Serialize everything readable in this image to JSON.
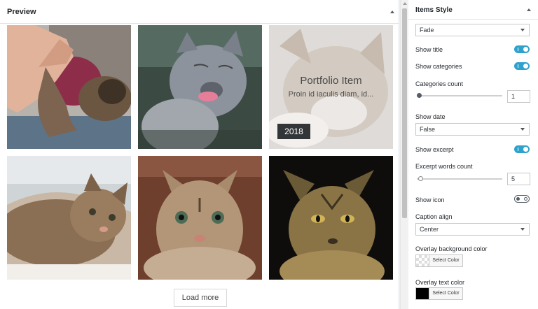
{
  "preview": {
    "title": "Preview",
    "overlay": {
      "title": "Portfolio Item",
      "excerpt": "Proin id iaculis diam, id...",
      "date": "2018"
    },
    "load_more": "Load more"
  },
  "settings": {
    "title": "Items Style",
    "style_select": "Fade",
    "show_title": {
      "label": "Show title",
      "on": true
    },
    "show_categories": {
      "label": "Show categories",
      "on": true
    },
    "categories_count": {
      "label": "Categories count",
      "value": "1"
    },
    "show_date": {
      "label": "Show date",
      "value": "False"
    },
    "show_excerpt": {
      "label": "Show excerpt",
      "on": true
    },
    "excerpt_words_count": {
      "label": "Excerpt words count",
      "value": "5"
    },
    "show_icon": {
      "label": "Show icon",
      "on": false
    },
    "caption_align": {
      "label": "Caption align",
      "value": "Center"
    },
    "overlay_bg_color": {
      "label": "Overlay background color",
      "button": "Select Color"
    },
    "overlay_text_color": {
      "label": "Overlay text color",
      "button": "Select Color",
      "color": "#000000"
    }
  },
  "colors": {
    "accent": "#2ea2cc",
    "date_badge": "#333638"
  }
}
